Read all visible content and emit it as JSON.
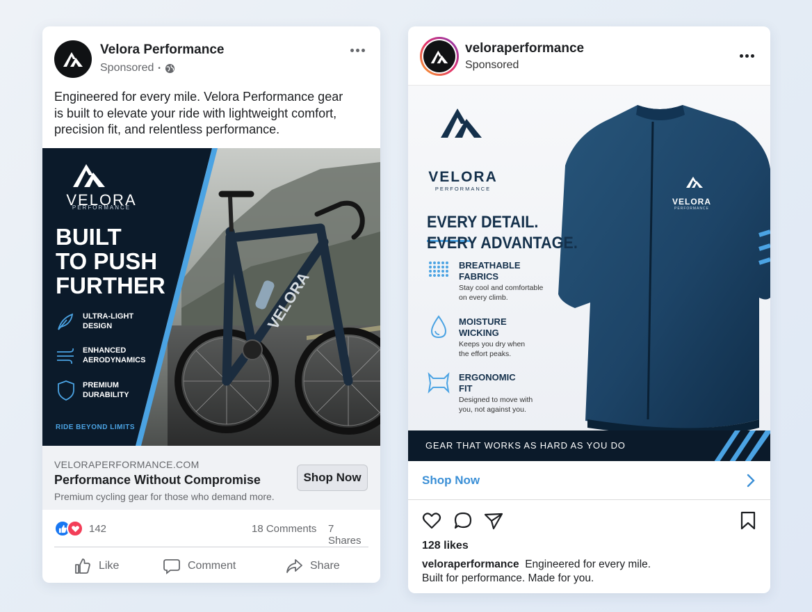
{
  "facebook_ad": {
    "page_name": "Velora Performance",
    "sponsored": "Sponsored",
    "post_text": "Engineered for every mile. Velora Performance gear is built to elevate your ride with lightweight comfort, precision fit, and relentless performance.",
    "creative": {
      "brand": "VELORA",
      "brand_sub": "PERFORMANCE",
      "headline_lines": [
        "BUILT",
        "TO PUSH",
        "FURTHER"
      ],
      "features": [
        {
          "icon": "feather-icon",
          "lines": [
            "ULTRA-LIGHT",
            "DESIGN"
          ]
        },
        {
          "icon": "wind-icon",
          "lines": [
            "ENHANCED",
            "AERODYNAMICS"
          ]
        },
        {
          "icon": "shield-icon",
          "lines": [
            "PREMIUM",
            "DURABILITY"
          ]
        }
      ],
      "tagline": "RIDE BEYOND LIMITS",
      "frame_text": "VELORA"
    },
    "link": {
      "url": "VELORAPERFORMANCE.COM",
      "headline": "Performance Without Compromise",
      "description": "Premium cycling gear for those who demand more.",
      "cta": "Shop Now"
    },
    "stats": {
      "reactions": "142",
      "comments": "18 Comments",
      "shares": "7 Shares"
    },
    "actions": {
      "like": "Like",
      "comment": "Comment",
      "share": "Share"
    }
  },
  "instagram_ad": {
    "username": "veloraperformance",
    "sponsored": "Sponsored",
    "creative": {
      "brand": "VELORA",
      "brand_sub": "PERFORMANCE",
      "headline_lines": [
        "EVERY DETAIL.",
        "EVERY ADVANTAGE."
      ],
      "features": [
        {
          "icon": "breathable-fabric-icon",
          "title": [
            "BREATHABLE",
            "FABRICS"
          ],
          "desc": [
            "Stay cool and comfortable",
            "on every climb."
          ]
        },
        {
          "icon": "water-drop-icon",
          "title": [
            "MOISTURE",
            "WICKING"
          ],
          "desc": [
            "Keeps you dry when",
            "the effort peaks."
          ]
        },
        {
          "icon": "ergonomic-fit-icon",
          "title": [
            "ERGONOMIC",
            "FIT"
          ],
          "desc": [
            "Designed to move with",
            "you, not against you."
          ]
        }
      ],
      "jersey_brand": "VELORA",
      "jersey_sub": "PERFORMANCE",
      "banner": "GEAR THAT WORKS AS HARD AS YOU DO"
    },
    "cta": "Shop Now",
    "likes": "128 likes",
    "caption_user": "veloraperformance",
    "caption_line1": "Engineered for every mile.",
    "caption_line2": "Built for performance. Made for you."
  },
  "colors": {
    "fb_link_bg": "#f0f2f5",
    "ig_link": "#3a8fd6",
    "navy": "#0b1a2a",
    "accent": "#4ba3e3"
  }
}
